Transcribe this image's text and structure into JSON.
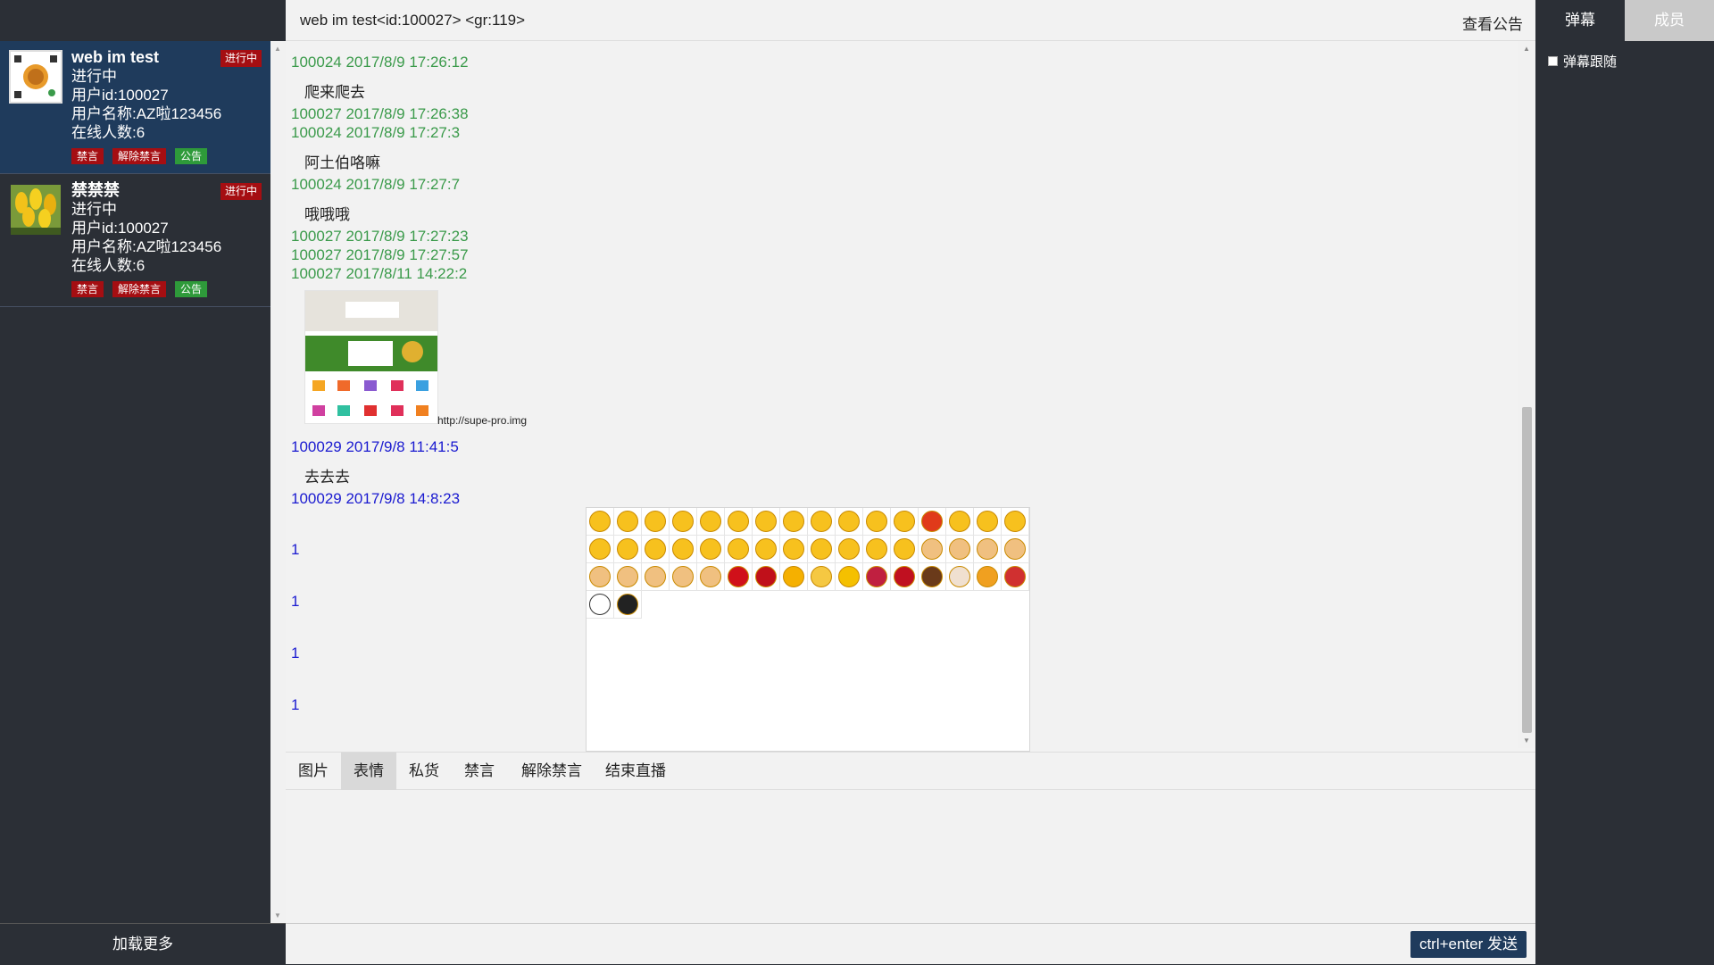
{
  "header": {
    "title": "web im test<id:100027> <gr:119>",
    "notice_label": "查看公告"
  },
  "rooms": [
    {
      "name": "web im test",
      "state": "进行中",
      "status_badge": "进行中",
      "user_id": "用户id:100027",
      "user_name": "用户名称:AZ啦123456",
      "online": "在线人数:6",
      "actions": {
        "mute": "禁言",
        "unmute": "解除禁言",
        "notice": "公告"
      }
    },
    {
      "name": "禁禁禁",
      "state": "进行中",
      "status_badge": "进行中",
      "user_id": "用户id:100027",
      "user_name": "用户名称:AZ啦123456",
      "online": "在线人数:6",
      "actions": {
        "mute": "禁言",
        "unmute": "解除禁言",
        "notice": "公告"
      }
    }
  ],
  "sidebar": {
    "load_more": "加载更多"
  },
  "messages": {
    "m1_meta": "100024 2017/8/9 17:26:12",
    "m1_text": "爬来爬去",
    "m2_meta": "100027 2017/8/9 17:26:38",
    "m3_meta": "100024 2017/8/9 17:27:3",
    "m3_text": "阿土伯咯嘛",
    "m4_meta": "100024 2017/8/9 17:27:7",
    "m4_text": "哦哦哦",
    "m5_meta": "100027 2017/8/9 17:27:23",
    "m6_meta": "100027 2017/8/9 17:27:57",
    "m7_meta": "100027 2017/8/11 14:22:2",
    "m7_caption": "http://supe-pro.img",
    "m8_meta": "100029 2017/9/8 11:41:5",
    "m8_text": "去去去",
    "m9_meta": "100029 2017/9/8 14:8:23",
    "stub_text": "1"
  },
  "toolbar": {
    "image": "图片",
    "emoji": "表情",
    "private": "私货",
    "mute": "禁言",
    "unmute": "解除禁言",
    "end_live": "结束直播"
  },
  "send_label": "ctrl+enter 发送",
  "right_panel": {
    "tab_danmu": "弹幕",
    "tab_members": "成员",
    "follow_label": "弹幕跟随"
  },
  "colors": {
    "sidebar_bg": "#2b2f36",
    "active_room": "#1f3b5c",
    "badge_red": "#a50e12",
    "notice_green": "#2e9a3a",
    "meta_green": "#3a9a4a",
    "meta_blue": "#1a1ad0"
  },
  "emojis": [
    "grin",
    "heart-eyes",
    "unamused",
    "flushed",
    "grimace",
    "kiss",
    "wink",
    "angry",
    "disappointed",
    "sweat",
    "sob",
    "tongue",
    "rage",
    "confounded",
    "relieved",
    "kissing",
    "cold-sweat",
    "joy",
    "blush",
    "cry",
    "yum",
    "fearful",
    "scream",
    "dizzy",
    "smirk",
    "scream-cat",
    "sleepy",
    "tired",
    "thumbs-up",
    "thumbs-down",
    "punch",
    "fist",
    "victory",
    "clap",
    "point-left",
    "point-down",
    "ok-hand",
    "heart",
    "broken-heart",
    "sun",
    "moon",
    "zap",
    "lips",
    "rose",
    "coffee",
    "cake",
    "beer",
    "gift",
    "soccer",
    "bomb"
  ]
}
